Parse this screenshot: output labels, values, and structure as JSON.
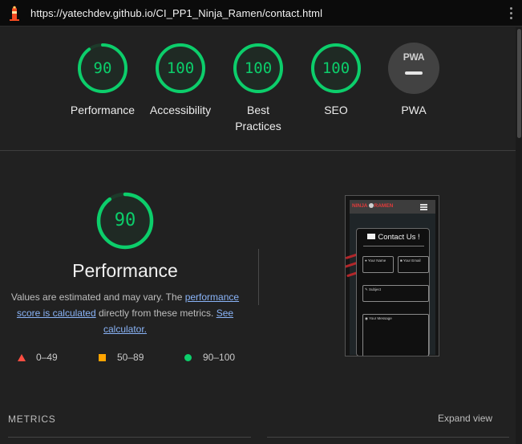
{
  "browser": {
    "url": "https://yatechdev.github.io/CI_PP1_Ninja_Ramen/contact.html"
  },
  "gauges": [
    {
      "label": "Performance",
      "score": "90"
    },
    {
      "label": "Accessibility",
      "score": "100"
    },
    {
      "label": "Best Practices",
      "score": "100"
    },
    {
      "label": "SEO",
      "score": "100"
    },
    {
      "label": "PWA",
      "badge": "PWA",
      "score": "—"
    }
  ],
  "performance": {
    "score": "90",
    "title": "Performance",
    "desc_pre": "Values are estimated and may vary. The ",
    "desc_link1": "performance score is calculated",
    "desc_mid": " directly from these metrics. ",
    "desc_link2": "See calculator."
  },
  "legend": [
    {
      "range": "0–49",
      "color": "#ff4e42"
    },
    {
      "range": "50–89",
      "color": "#ffa400"
    },
    {
      "range": "90–100",
      "color": "#0cce6b"
    }
  ],
  "screenshot": {
    "brand_left": "NINJA",
    "brand_right": "RAMEN",
    "card_title": "Contact Us !",
    "fields": {
      "name": "Your Name",
      "email": "Your Email",
      "subject": "Subject",
      "message": "Your Message"
    }
  },
  "metrics": {
    "heading": "METRICS",
    "expand": "Expand view"
  },
  "colors": {
    "pass": "#0cce6b",
    "average": "#ffa400",
    "fail": "#ff4e42",
    "background": "#212121"
  }
}
